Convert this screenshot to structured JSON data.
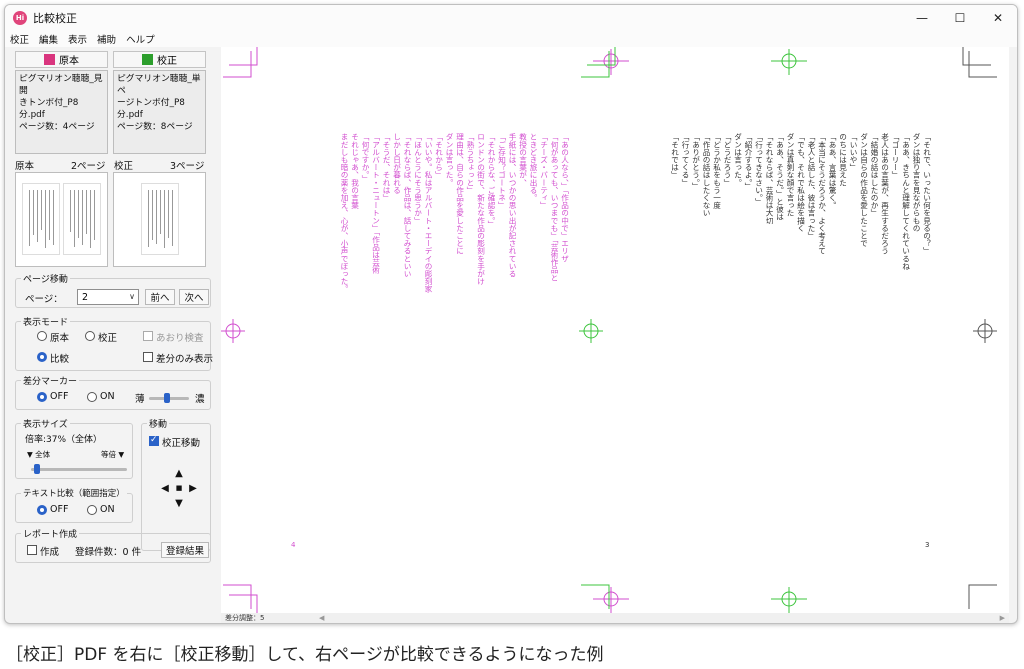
{
  "window": {
    "title": "比較校正",
    "app_icon_text": "Hi",
    "controls": {
      "minimize": "—",
      "maximize": "☐",
      "close": "✕"
    }
  },
  "menu": [
    "校正",
    "編集",
    "表示",
    "補助",
    "ヘルプ"
  ],
  "files": {
    "original": {
      "label": "原本",
      "color": "#d9357e",
      "name_line1": "ピグマリオン聴聴_見開",
      "name_line2": "きトンボ付_P8分.pdf",
      "page_count": "ページ数：4ページ",
      "page_label": "原本",
      "current_page": "2ページ"
    },
    "revised": {
      "label": "校正",
      "color": "#2c9e2c",
      "name_line1": "ピグマリオン聴聴_単ペ",
      "name_line2": "ージトンボ付_P8分.pdf",
      "page_count": "ページ数：8ページ",
      "page_label": "校正",
      "current_page": "3ページ"
    }
  },
  "page_nav": {
    "group": "ページ移動",
    "label": "ページ：",
    "value": "2",
    "prev": "前へ",
    "next": "次へ"
  },
  "display_mode": {
    "group": "表示モード",
    "original": "原本",
    "revised": "校正",
    "flicker": "あおり検査",
    "compare": "比較",
    "diff_only": "差分のみ表示"
  },
  "diff_marker": {
    "group": "差分マーカー",
    "off": "OFF",
    "on": "ON",
    "light": "薄",
    "dark": "濃",
    "intensity": 0.45
  },
  "display_size": {
    "group": "表示サイズ",
    "zoom_text": "倍率:37%（全体）",
    "fit_all": "▼ 全体",
    "actual": "等倍 ▼",
    "zoom_fraction": 0.06
  },
  "move": {
    "group": "移動",
    "revise_move": "校正移動",
    "up": "▲",
    "down": "▼",
    "left": "◀",
    "right": "▶",
    "center": "■"
  },
  "text_compare": {
    "group": "テキスト比較（範囲指定）",
    "off": "OFF",
    "on": "ON"
  },
  "report": {
    "group": "レポート作成",
    "create": "作成",
    "count": "登録件数：0 件",
    "result": "登録結果"
  },
  "viewer": {
    "left_page_number": "4",
    "right_page_number": "3",
    "pink_color": "#d24ecf",
    "green_color": "#3cc43c",
    "pink_columns": [
      "「あの人なら、」「作品の中で」エリザ",
      "「何があっても、いつまでも」「芸術作品と",
      "「チーズ・パーティ」",
      "ときどき旅に出る。",
      "教授の言葉が、",
      "手紙には、いつかの思い出が記されている",
      "「ご存知？ゴートネ」",
      "「それからな、ご確認を。」",
      "ロンドンの街で、新たな作品の彫刻を手がけ",
      "「熟うちょっと」",
      "理由は、自らの作品を愛したことに",
      "ダンは言った。",
      "「それから」",
      "「いいや。私はアルバート・エーデイの彫刻家",
      "「ほんとうにそう思うか」",
      "「それならば、作品は、話してみるといい",
      "しかし日が暮れる",
      "「そうだ、それは」",
      "「アルバート・ニュートン」「作品は芸術",
      "「何ですか。」",
      "それじゃあ、我の言葉",
      "まだしも暗の薬を加え、心が、小声でぼった。"
    ],
    "black_columns": [
      "「それで、いったい何を見るの？」",
      "ダンは独り言を見ながらもの",
      "「ああ、きちんと理解してくれているね",
      "「ゴーリー」",
      "老人はあの言葉が、再生するだろう",
      "「結婚の話はしたのか」",
      "ダンは自らの作品を愛したことで",
      "「いいや」",
      "のちには見えた",
      "「ああ、言葉は驚く。",
      "「本当にそうだろうか、よく考えて",
      "「老人と話した、彼は言った」",
      "「でも、それで私は絵を描く",
      "ダンは真剣な顔で言った",
      "「ああ、そうだ。」と彼は",
      "「それならば、芸術は大切",
      "「行ってきなさい。」",
      "「紹介するよ。」",
      "ダンは言った。",
      "「どうだろう」",
      "「どうか私をもう一度",
      "「作品の話はしたくない",
      "「ありがとう。」",
      "「行ってくる」",
      "「それでは」"
    ]
  },
  "status": {
    "label": "差分調整：5"
  },
  "caption": "［校正］PDF を右に［校正移動］して、右ページが比較できるようになった例"
}
